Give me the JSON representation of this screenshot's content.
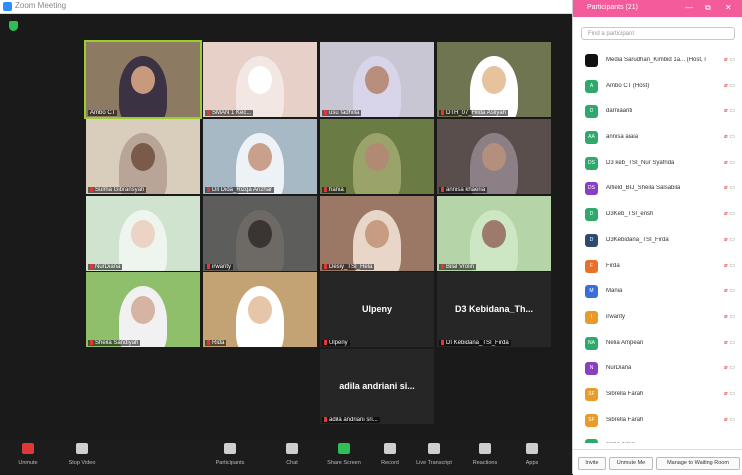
{
  "window": {
    "title": "Zoom Meeting"
  },
  "tiles": [
    {
      "name": "Ambo CT",
      "speaking": true,
      "muted": false,
      "bg": "#8d7a62",
      "skin": "#c79a7d",
      "scarf": "#3b3244"
    },
    {
      "name": "SMAN 1 Kec...",
      "muted": true,
      "bg": "#e7d0c8",
      "skin": "#ffffff",
      "scarf": "#f2e7e3"
    },
    {
      "name": "usu fadhilla",
      "muted": true,
      "bg": "#c9c6d4",
      "skin": "#b88f7c",
      "scarf": "#d8d4ea"
    },
    {
      "name": "DTH_07_Hilda Asliyah",
      "muted": true,
      "bg": "#6f7550",
      "skin": "#e7c39d",
      "scarf": "#ffffff"
    },
    {
      "name": "Sulma Gibransyah",
      "muted": true,
      "bg": "#d9cdbb",
      "skin": "#7a5a48",
      "scarf": "#b9a598"
    },
    {
      "name": "Dil Dida_Rizqa Anzhar",
      "muted": true,
      "bg": "#a8b9c6",
      "skin": "#c8a08c",
      "scarf": "#ecf2f6"
    },
    {
      "name": "hania",
      "muted": true,
      "bg": "#6b7b44",
      "skin": "#b08a72",
      "scarf": "#9aa46a"
    },
    {
      "name": "annisa khaeria",
      "muted": true,
      "bg": "#5a4e4c",
      "skin": "#b48f7e",
      "scarf": "#8d7f86"
    },
    {
      "name": "NurDiana",
      "muted": true,
      "bg": "#cfe3cf",
      "skin": "#ecd3c3",
      "scarf": "#eef5ee"
    },
    {
      "name": "irwanty",
      "muted": true,
      "bg": "#5d5e5c",
      "skin": "#3a3532",
      "scarf": "#6d6a66"
    },
    {
      "name": "Desiy_TSI_Hela",
      "muted": true,
      "bg": "#9a7865",
      "skin": "#c89c83",
      "scarf": "#e8d7c9"
    },
    {
      "name": "Bilal Vrolin",
      "muted": true,
      "bg": "#b5d5a8",
      "skin": "#9c7b6c",
      "scarf": "#cde6c4"
    },
    {
      "name": "Sheila Sandiyah",
      "muted": true,
      "bg": "#8fbf6a",
      "skin": "#d5b4a3",
      "scarf": "#f1f1f1"
    },
    {
      "name": "Rida",
      "muted": true,
      "bg": "#c3a273",
      "skin": "#e6c6a8",
      "scarf": "#ffffff"
    },
    {
      "name": "Ulpeny",
      "label": "Ulpeny",
      "muted": true
    },
    {
      "name": "DI Kebidana_TSI_Firda",
      "label": "D3 Kebidana_Th...",
      "muted": true
    },
    {
      "name": "adila andriani sri...",
      "label": "adila andriani si...",
      "muted": true
    }
  ],
  "toolbar": {
    "items": [
      {
        "label": "Unmute",
        "color": "#e03838"
      },
      {
        "label": "Stop Video",
        "color": "#cfcfcf"
      },
      {
        "label": "Participants",
        "color": "#cfcfcf"
      },
      {
        "label": "Chat",
        "color": "#cfcfcf"
      },
      {
        "label": "Share Screen",
        "color": "#2fbe54"
      },
      {
        "label": "Record",
        "color": "#cfcfcf"
      },
      {
        "label": "Live Transcript",
        "color": "#cfcfcf"
      },
      {
        "label": "Reactions",
        "color": "#cfcfcf"
      },
      {
        "label": "Apps",
        "color": "#cfcfcf"
      }
    ]
  },
  "participants_panel": {
    "title": "Participants (21)",
    "search_placeholder": "Find a participant",
    "list": [
      {
        "name": "Media Sarudhan_Kimbid 1a... (Host, me)",
        "initials": "",
        "color": "#111111"
      },
      {
        "name": "Ambo CT (Host)",
        "initials": "A",
        "color": "#2ea86b"
      },
      {
        "name": "darniaanti",
        "initials": "D",
        "color": "#2ea86b"
      },
      {
        "name": "annisa aiaia",
        "initials": "AA",
        "color": "#2ea86b"
      },
      {
        "name": "D3 keb_TSI_Nur Syafrida",
        "initials": "DS",
        "color": "#2ea86b"
      },
      {
        "name": "Alfield_BIJ_Sheila Salsabila",
        "initials": "DS",
        "color": "#8a3fc2"
      },
      {
        "name": "D3Keb_TSI_ensh",
        "initials": "D",
        "color": "#2ea86b"
      },
      {
        "name": "D3Kebidana_TSI_Firda",
        "initials": "D",
        "color": "#2d4b6e"
      },
      {
        "name": "Firda",
        "initials": "F",
        "color": "#e8702a"
      },
      {
        "name": "Mania",
        "initials": "M",
        "color": "#3a6fd8"
      },
      {
        "name": "irwanty",
        "initials": "I",
        "color": "#e89a2a"
      },
      {
        "name": "Nelia Ampeari",
        "initials": "NA",
        "color": "#2ea86b"
      },
      {
        "name": "NurDiana",
        "initials": "N",
        "color": "#8a3fc2"
      },
      {
        "name": "Sibrella Farah",
        "initials": "SF",
        "color": "#e89a2a"
      },
      {
        "name": "Sibrella Farah",
        "initials": "SF",
        "color": "#e89a2a"
      },
      {
        "name": "salsa nilesi",
        "initials": "",
        "color": "#2ea86b"
      }
    ],
    "buttons": {
      "invite": "Invite",
      "unmute": "Unmute Me",
      "manage": "Manage to Waiting Room"
    }
  }
}
